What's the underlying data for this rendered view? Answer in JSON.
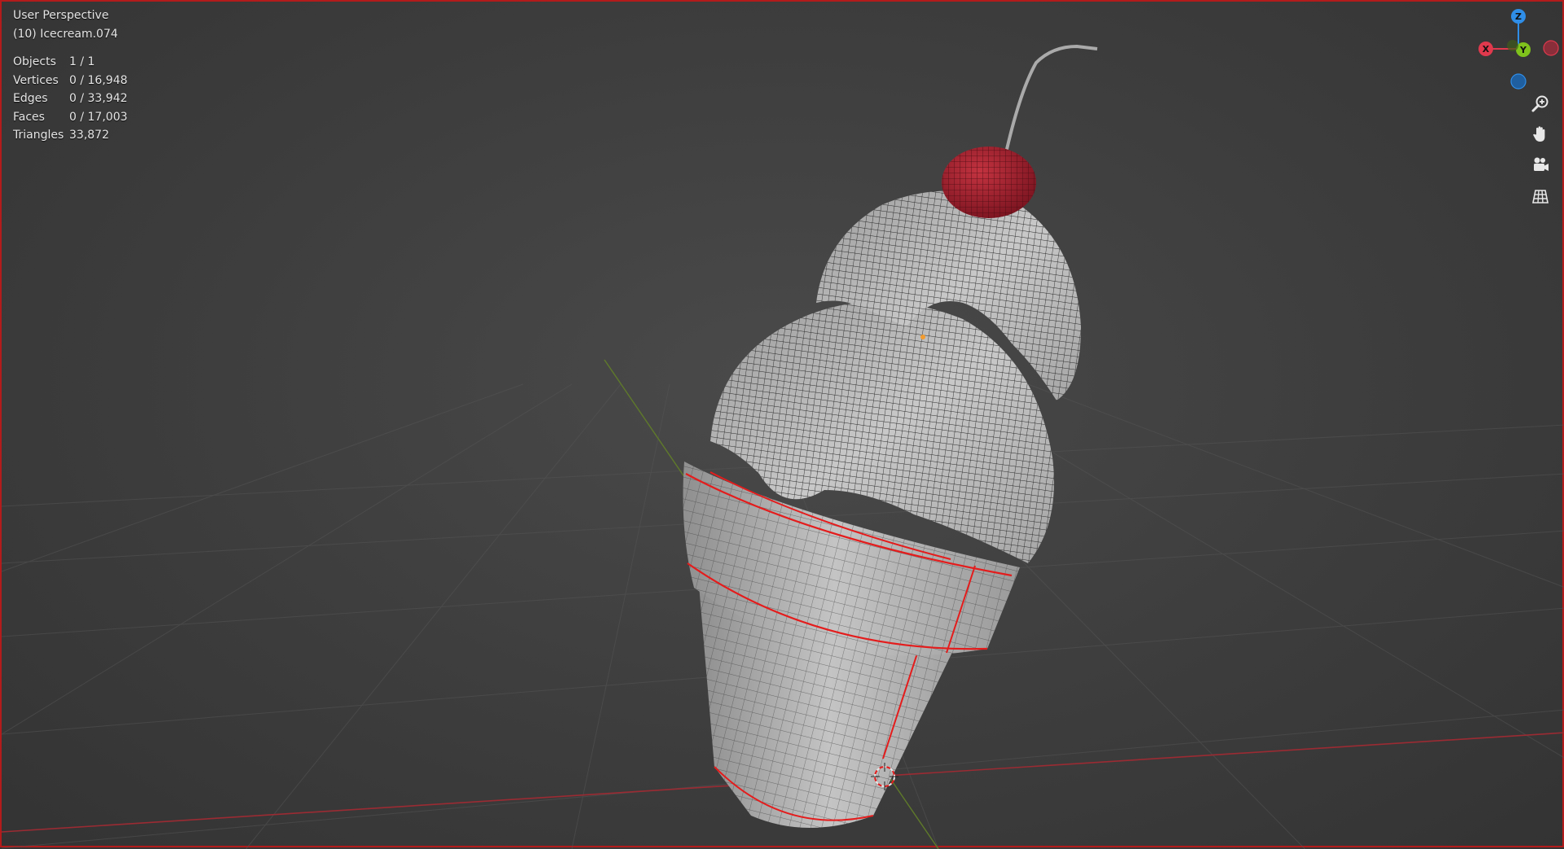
{
  "viewport": {
    "view_name": "User Perspective",
    "object_name": "(10) Icecream.074",
    "stats": [
      {
        "label": "Objects",
        "value": "1 / 1"
      },
      {
        "label": "Vertices",
        "value": "0 / 16,948"
      },
      {
        "label": "Edges",
        "value": "0 / 33,942"
      },
      {
        "label": "Faces",
        "value": "0 / 17,003"
      },
      {
        "label": "Triangles",
        "value": "33,872"
      }
    ],
    "border_color": "#b31b1b"
  },
  "gizmo": {
    "z_label": "Z",
    "x_label": "X",
    "y_label": "Y",
    "x_color": "#e0394d",
    "y_color": "#7fc31c",
    "z_color": "#2f8ee8"
  },
  "nav_buttons": {
    "icons": [
      "zoom-icon",
      "hand-icon",
      "camera-icon",
      "grid-icon"
    ]
  },
  "colors": {
    "seam": "#e41c1c",
    "cream": "#b9b9b9",
    "cone": "#bdbdbd",
    "cherry": "#a81f2a",
    "wire": "#222222"
  }
}
